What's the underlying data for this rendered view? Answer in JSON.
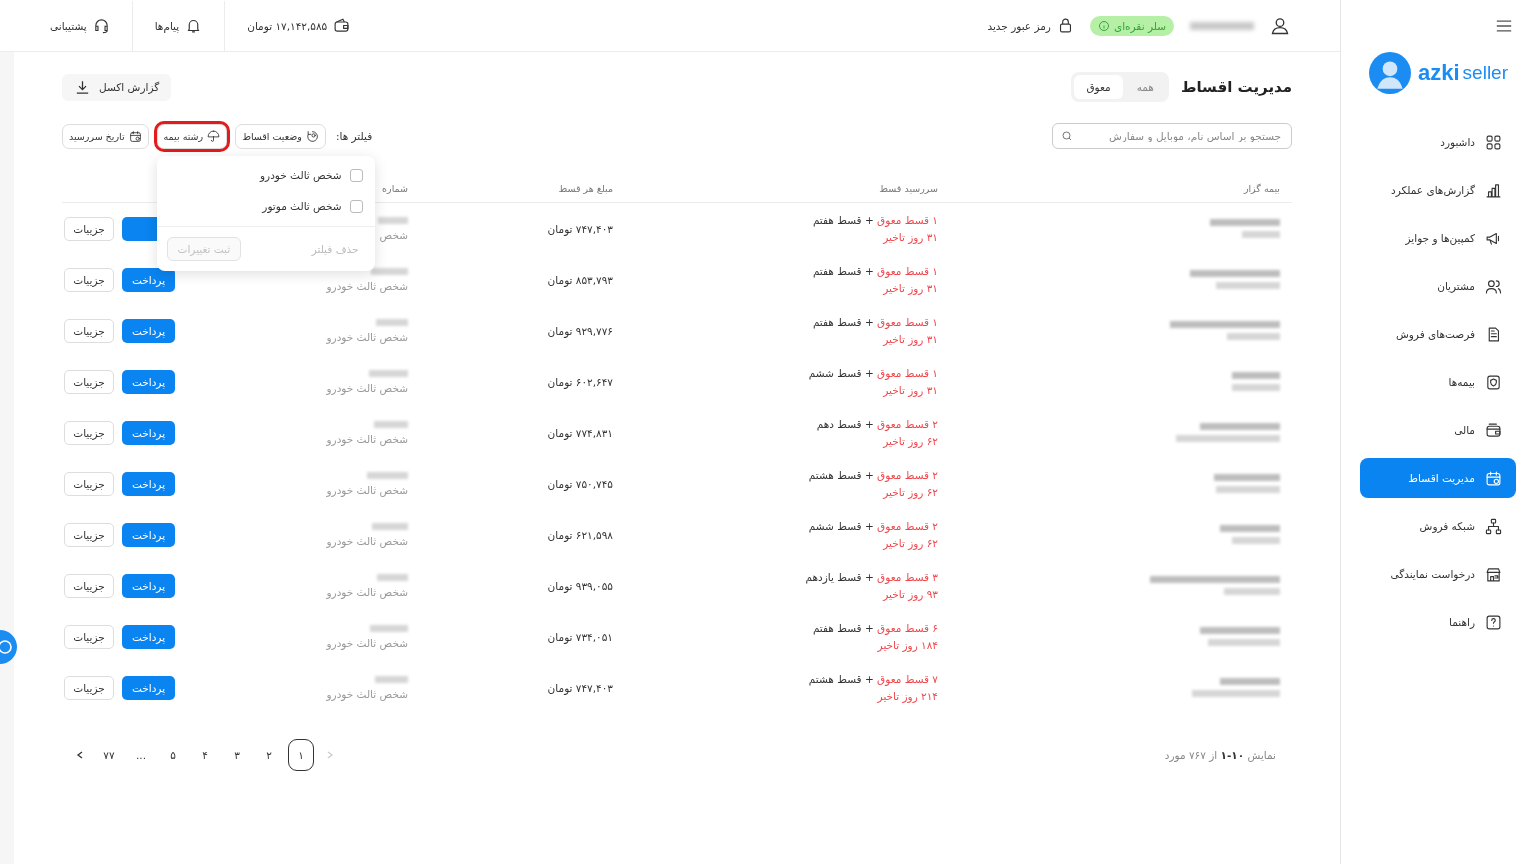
{
  "sidebar": {
    "logo": {
      "brand": "azki",
      "product": "seller"
    },
    "items": [
      {
        "label": "داشبورد",
        "selected": false
      },
      {
        "label": "گزارش‌های عملکرد",
        "selected": false
      },
      {
        "label": "کمپین‌ها و جوایز",
        "selected": false
      },
      {
        "label": "مشتریان",
        "selected": false
      },
      {
        "label": "فرصت‌های فروش",
        "selected": false
      },
      {
        "label": "بیمه‌ها",
        "selected": false
      },
      {
        "label": "مالی",
        "selected": false
      },
      {
        "label": "مدیریت اقساط",
        "selected": true
      },
      {
        "label": "شبکه فروش",
        "selected": false
      },
      {
        "label": "درخواست نمایندگی",
        "selected": false
      },
      {
        "label": "راهنما",
        "selected": false
      }
    ]
  },
  "header": {
    "badge": "سلر نقره‌ای",
    "change_password": "رمز عبور جدید",
    "wallet": "۱۷,۱۴۲,۵۸۵ تومان",
    "messages": "پیام‌ها",
    "support": "پشتیبانی"
  },
  "page": {
    "title": "مدیریت اقساط",
    "tabs": [
      {
        "label": "همه",
        "selected": false
      },
      {
        "label": "معوق",
        "selected": true
      }
    ],
    "search": {
      "placeholder": "جستجو بر اساس نام، موبایل و سفارش"
    },
    "export_button": "گزارش اکسل",
    "filters": {
      "label": "فیلتر ها:",
      "chips": [
        {
          "label": "وضعیت اقساط",
          "highlighted": false,
          "open": false
        },
        {
          "label": "رشته بیمه",
          "highlighted": true,
          "open": true
        },
        {
          "label": "تاریخ سررسید",
          "highlighted": false,
          "open": false
        }
      ]
    },
    "dropdown": {
      "options": [
        {
          "label": "شخص ثالث خودرو",
          "checked": false
        },
        {
          "label": "شخص ثالث موتور",
          "checked": false
        }
      ],
      "clear": "حذف فیلتر",
      "apply": "ثبت تغییرات"
    }
  },
  "table": {
    "columns": [
      "بیمه گزار",
      "سررسید قسط",
      "مبلغ هر قسط",
      "شماره"
    ],
    "rows": [
      {
        "overdue": "۱ قسط معوق",
        "next": "+ قسط هفتم",
        "delay": "۳۱ روز تاخیر",
        "amount": "۷۴۷,۴۰۳ تومان",
        "policy_type": "شخص",
        "details": "جزییات"
      },
      {
        "overdue": "۱ قسط معوق",
        "next": "+ قسط هفتم",
        "delay": "۳۱ روز تاخیر",
        "amount": "۸۵۳,۷۹۳ تومان",
        "policy_type": "شخص ثالث خودرو",
        "pay": "پرداخت",
        "details": "جزییات"
      },
      {
        "overdue": "۱ قسط معوق",
        "next": "+ قسط هفتم",
        "delay": "۳۱ روز تاخیر",
        "amount": "۹۲۹,۷۷۶ تومان",
        "policy_type": "شخص ثالث خودرو",
        "pay": "پرداخت",
        "details": "جزییات"
      },
      {
        "overdue": "۱ قسط معوق",
        "next": "+ قسط ششم",
        "delay": "۳۱ روز تاخیر",
        "amount": "۶۰۲,۶۴۷ تومان",
        "policy_type": "شخص ثالث خودرو",
        "pay": "پرداخت",
        "details": "جزییات"
      },
      {
        "overdue": "۲ قسط معوق",
        "next": "+ قسط دهم",
        "delay": "۶۲ روز تاخیر",
        "amount": "۷۷۴,۸۳۱ تومان",
        "policy_type": "شخص ثالث خودرو",
        "pay": "پرداخت",
        "details": "جزییات"
      },
      {
        "overdue": "۲ قسط معوق",
        "next": "+ قسط هشتم",
        "delay": "۶۲ روز تاخیر",
        "amount": "۷۵۰,۷۴۵ تومان",
        "policy_type": "شخص ثالث خودرو",
        "pay": "پرداخت",
        "details": "جزییات"
      },
      {
        "overdue": "۲ قسط معوق",
        "next": "+ قسط ششم",
        "delay": "۶۲ روز تاخیر",
        "amount": "۶۲۱,۵۹۸ تومان",
        "policy_type": "شخص ثالث خودرو",
        "pay": "پرداخت",
        "details": "جزییات"
      },
      {
        "overdue": "۳ قسط معوق",
        "next": "+ قسط یازدهم",
        "delay": "۹۳ روز تاخیر",
        "amount": "۹۳۹,۰۵۵ تومان",
        "policy_type": "شخص ثالث خودرو",
        "pay": "پرداخت",
        "details": "جزییات"
      },
      {
        "overdue": "۶ قسط معوق",
        "next": "+ قسط هفتم",
        "delay": "۱۸۴ روز تاخیر",
        "amount": "۷۳۴,۰۵۱ تومان",
        "policy_type": "شخص ثالث خودرو",
        "pay": "پرداخت",
        "details": "جزییات"
      },
      {
        "overdue": "۷ قسط معوق",
        "next": "+ قسط هشتم",
        "delay": "۲۱۴ روز تاخیر",
        "amount": "۷۴۷,۴۰۳ تومان",
        "policy_type": "شخص ثالث خودرو",
        "pay": "پرداخت",
        "details": "جزییات"
      }
    ],
    "summary": "نمایش **۱۰-۱** از ۷۶۷ مورد",
    "pagination": {
      "pages": [
        {
          "label": "۱",
          "selected": true
        },
        {
          "label": "۲",
          "selected": false
        },
        {
          "label": "۳",
          "selected": false
        },
        {
          "label": "۴",
          "selected": false
        },
        {
          "label": "۵",
          "selected": false
        },
        {
          "label": "...",
          "selected": false
        },
        {
          "label": "۷۷",
          "selected": false
        }
      ],
      "prev_disabled": true,
      "next_disabled": false
    }
  }
}
